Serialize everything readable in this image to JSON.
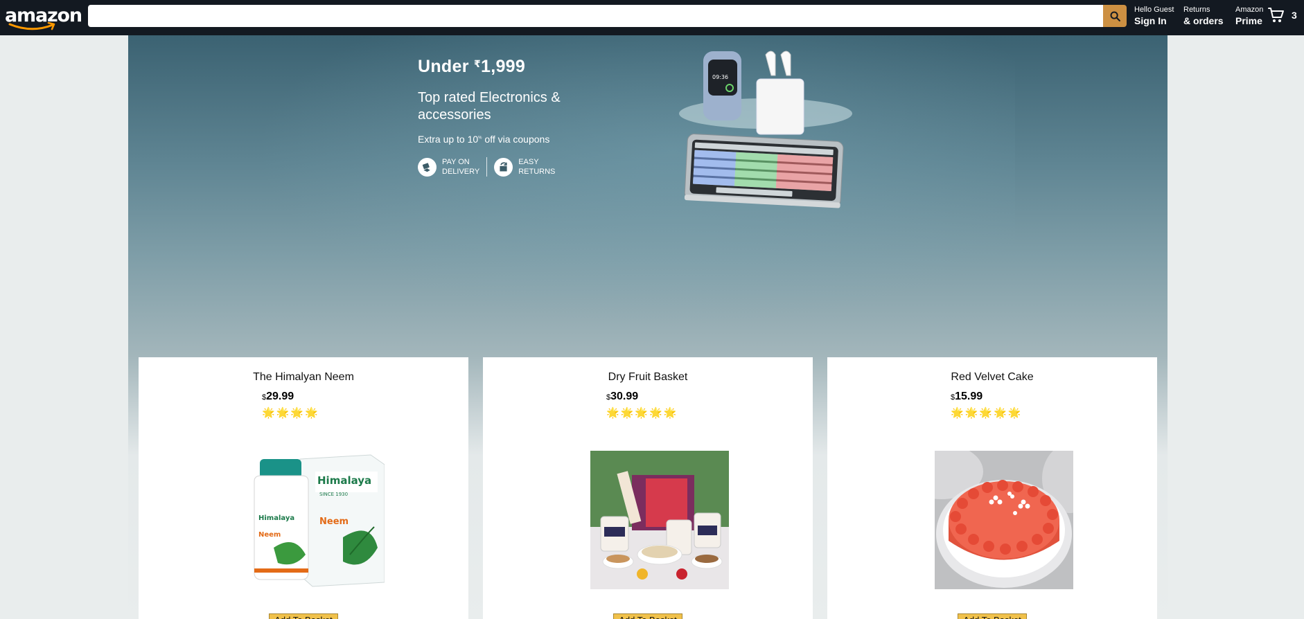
{
  "header": {
    "logo_text": "amazon",
    "search": {
      "value": "",
      "placeholder": ""
    },
    "nav": [
      {
        "line1": "Hello Guest",
        "line2": "Sign In"
      },
      {
        "line1": "Returns",
        "line2": "& orders"
      },
      {
        "line1": "Amazon",
        "line2": "Prime"
      }
    ],
    "cart_count": "3",
    "icons": {
      "search": "search-icon",
      "cart": "cart-icon"
    },
    "colors": {
      "bar": "#131921",
      "search_button": "#cd9042"
    }
  },
  "banner": {
    "headline_prefix": "Under ",
    "headline_currency": "₹",
    "headline_amount": "1,999",
    "subtitle": "Top rated Electronics & accessories",
    "coupon_text_before": "Extra up to 10",
    "coupon_sup": "%",
    "coupon_text_after": " off via coupons",
    "badge_pay_line1": "PAY ON",
    "badge_pay_line2": "DELIVERY",
    "badge_returns_line1": "EASY",
    "badge_returns_line2": "RETURNS",
    "product_image": "smartwatch-earbuds-keyboard"
  },
  "products": [
    {
      "title": "The Himalyan Neem",
      "currency": "$",
      "price": "29.99",
      "rating": 4,
      "rating_stars": "🌟🌟🌟🌟",
      "image": "himalaya-neem-bottle-and-box",
      "button": "Add To Basket"
    },
    {
      "title": "Dry Fruit Basket",
      "currency": "$",
      "price": "30.99",
      "rating": 5,
      "rating_stars": "🌟🌟🌟🌟🌟",
      "image": "dry-fruit-gift-basket",
      "button": "Add To Basket"
    },
    {
      "title": "Red Velvet Cake",
      "currency": "$",
      "price": "15.99",
      "rating": 5,
      "rating_stars": "🌟🌟🌟🌟🌟",
      "image": "red-velvet-cake",
      "button": "Add To Basket"
    }
  ]
}
